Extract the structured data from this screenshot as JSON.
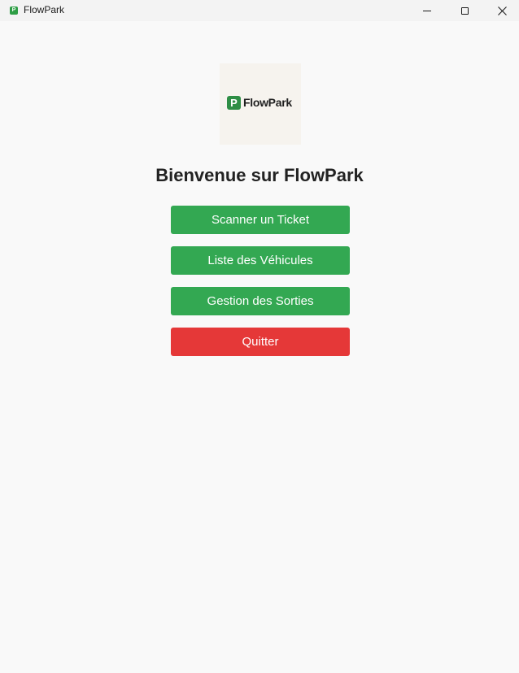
{
  "window": {
    "title": "FlowPark",
    "app_icon_letter": "P",
    "controls": [
      "minimize-icon",
      "maximize-icon",
      "close-icon"
    ]
  },
  "logo": {
    "mark_letter": "P",
    "text": "FlowPark"
  },
  "main": {
    "heading": "Bienvenue sur FlowPark",
    "buttons": [
      {
        "label": "Scanner un Ticket",
        "color": "#33a852"
      },
      {
        "label": "Liste des Véhicules",
        "color": "#33a852"
      },
      {
        "label": "Gestion des Sorties",
        "color": "#33a852"
      },
      {
        "label": "Quitter",
        "color": "#e53838"
      }
    ]
  },
  "colors": {
    "accent": "#33a852",
    "danger": "#e53838",
    "background": "#f9f9f9"
  }
}
